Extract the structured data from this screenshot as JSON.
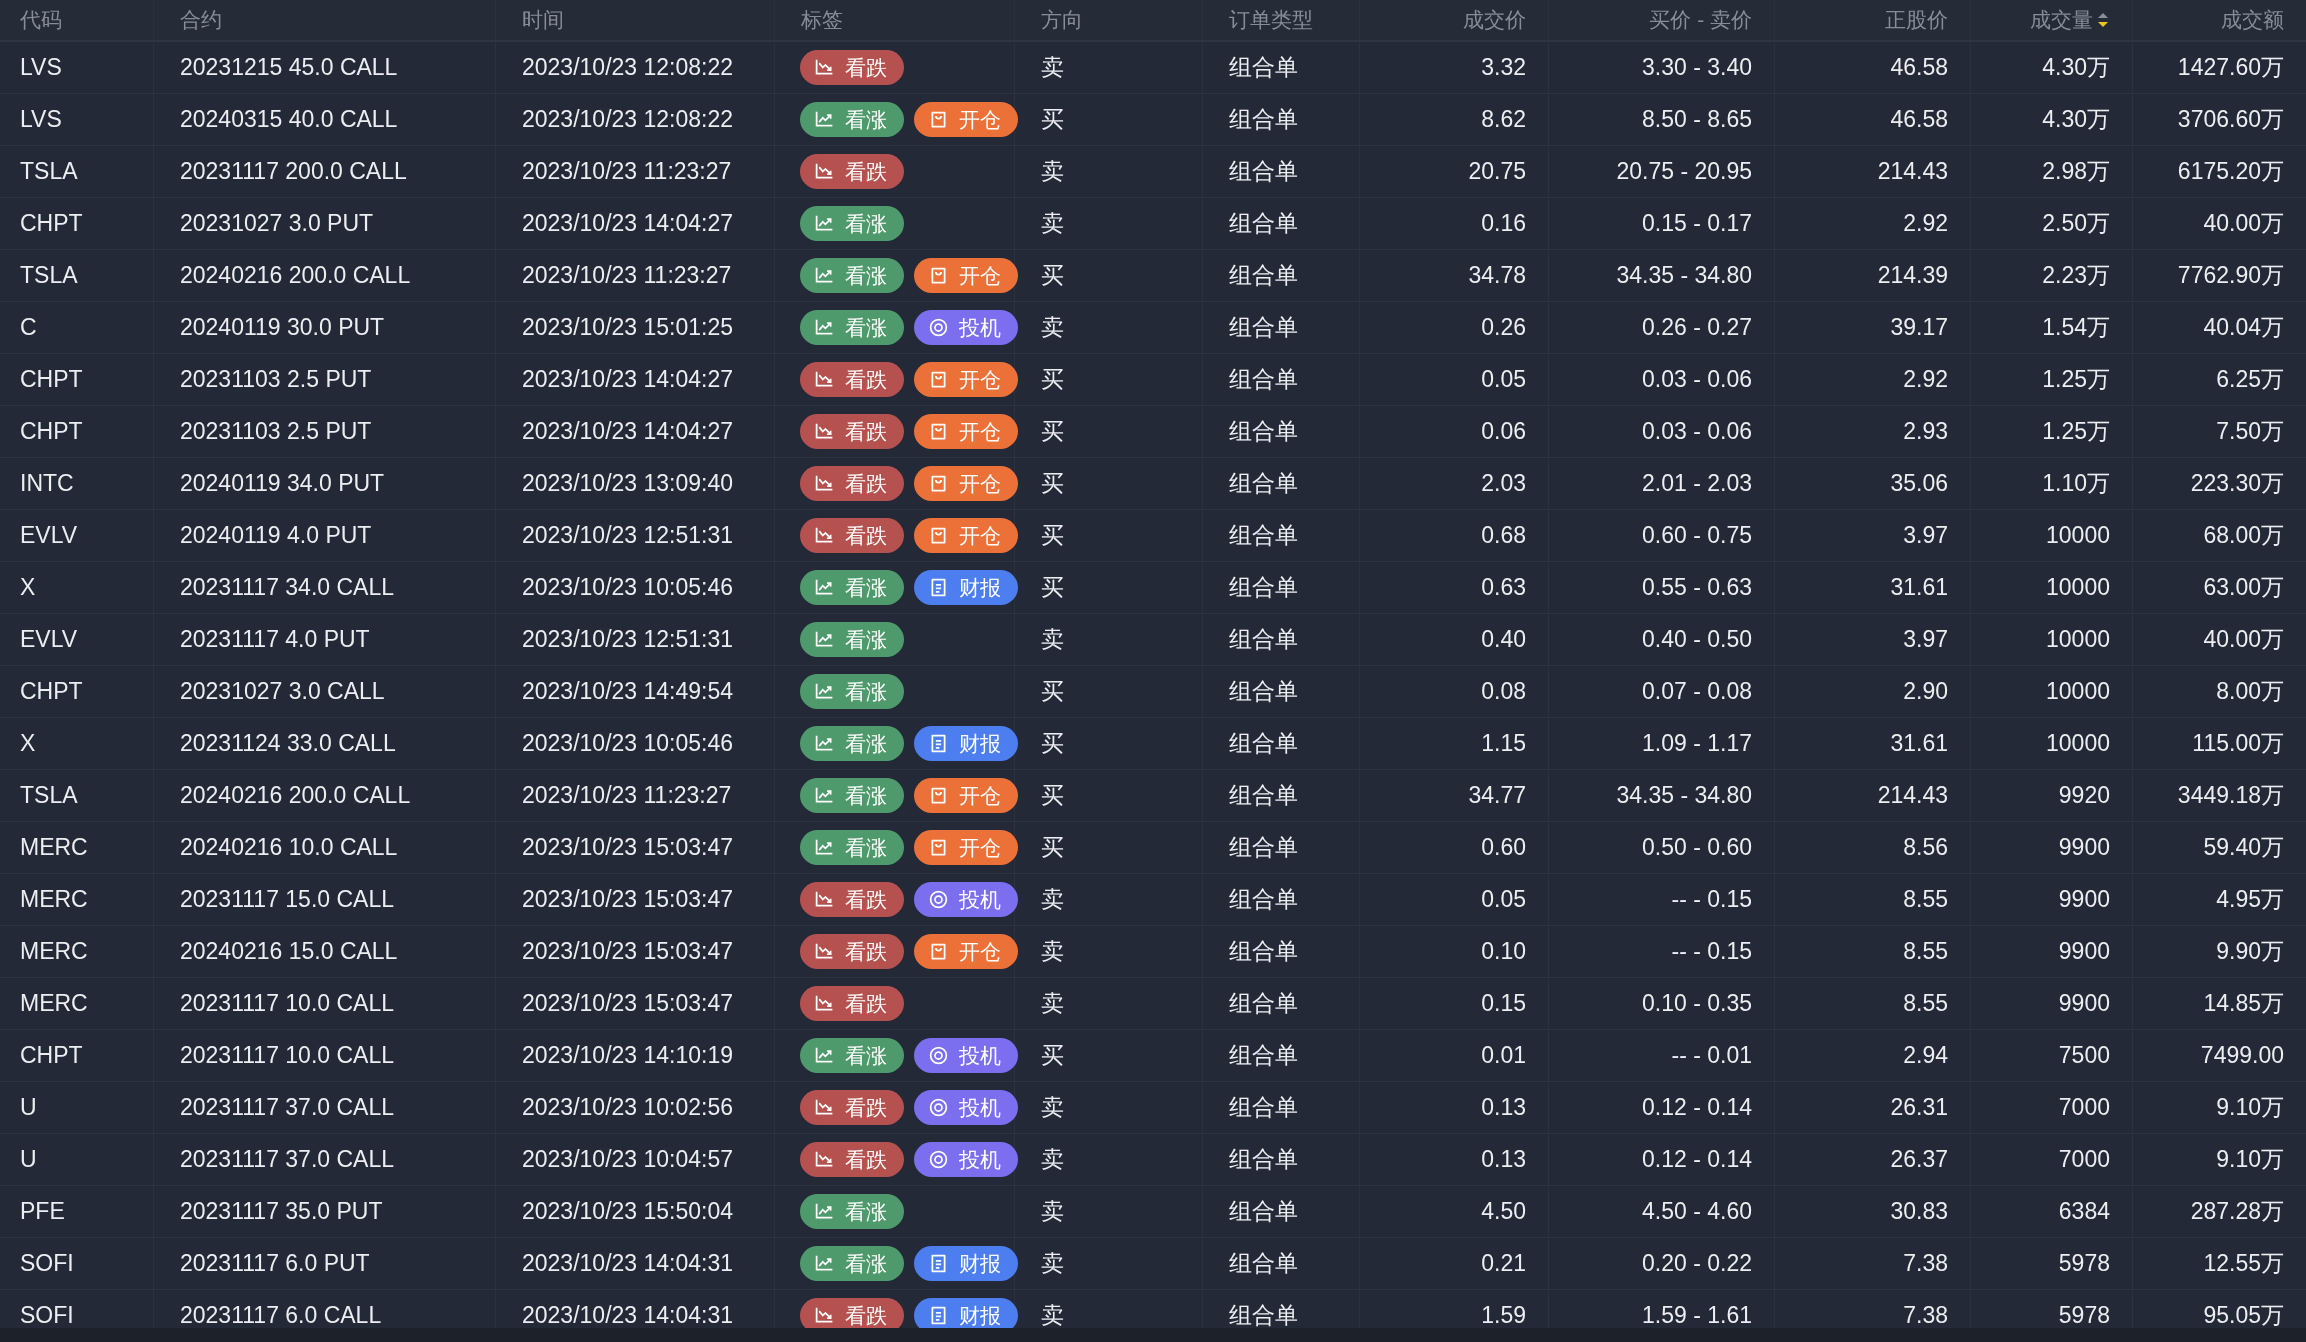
{
  "columns": [
    {
      "label": "代码"
    },
    {
      "label": "合约"
    },
    {
      "label": "时间"
    },
    {
      "label": "标签"
    },
    {
      "label": "方向"
    },
    {
      "label": "订单类型"
    },
    {
      "label": "成交价"
    },
    {
      "label": "买价 - 卖价"
    },
    {
      "label": "正股价"
    },
    {
      "label": "成交量",
      "sorted_descending": true
    },
    {
      "label": "成交额"
    }
  ],
  "rows": [
    {
      "code": "LVS",
      "contract": "20231215 45.0 CALL",
      "time": "2023/10/23 12:08:22",
      "tags": [
        {
          "kind": "bear",
          "label": "看跌"
        }
      ],
      "direction": "卖",
      "order_type": "组合单",
      "price": "3.32",
      "bid_ask": "3.30 - 3.40",
      "underlying": "46.58",
      "volume": "4.30万",
      "amount": "1427.60万"
    },
    {
      "code": "LVS",
      "contract": "20240315 40.0 CALL",
      "time": "2023/10/23 12:08:22",
      "tags": [
        {
          "kind": "bull",
          "label": "看涨"
        },
        {
          "kind": "open",
          "label": "开仓"
        }
      ],
      "direction": "买",
      "order_type": "组合单",
      "price": "8.62",
      "bid_ask": "8.50 - 8.65",
      "underlying": "46.58",
      "volume": "4.30万",
      "amount": "3706.60万"
    },
    {
      "code": "TSLA",
      "contract": "20231117 200.0 CALL",
      "time": "2023/10/23 11:23:27",
      "tags": [
        {
          "kind": "bear",
          "label": "看跌"
        }
      ],
      "direction": "卖",
      "order_type": "组合单",
      "price": "20.75",
      "bid_ask": "20.75 - 20.95",
      "underlying": "214.43",
      "volume": "2.98万",
      "amount": "6175.20万"
    },
    {
      "code": "CHPT",
      "contract": "20231027 3.0 PUT",
      "time": "2023/10/23 14:04:27",
      "tags": [
        {
          "kind": "bull",
          "label": "看涨"
        }
      ],
      "direction": "卖",
      "order_type": "组合单",
      "price": "0.16",
      "bid_ask": "0.15 - 0.17",
      "underlying": "2.92",
      "volume": "2.50万",
      "amount": "40.00万"
    },
    {
      "code": "TSLA",
      "contract": "20240216 200.0 CALL",
      "time": "2023/10/23 11:23:27",
      "tags": [
        {
          "kind": "bull",
          "label": "看涨"
        },
        {
          "kind": "open",
          "label": "开仓"
        }
      ],
      "direction": "买",
      "order_type": "组合单",
      "price": "34.78",
      "bid_ask": "34.35 - 34.80",
      "underlying": "214.39",
      "volume": "2.23万",
      "amount": "7762.90万"
    },
    {
      "code": "C",
      "contract": "20240119 30.0 PUT",
      "time": "2023/10/23 15:01:25",
      "tags": [
        {
          "kind": "bull",
          "label": "看涨"
        },
        {
          "kind": "spec",
          "label": "投机"
        }
      ],
      "direction": "卖",
      "order_type": "组合单",
      "price": "0.26",
      "bid_ask": "0.26 - 0.27",
      "underlying": "39.17",
      "volume": "1.54万",
      "amount": "40.04万"
    },
    {
      "code": "CHPT",
      "contract": "20231103 2.5 PUT",
      "time": "2023/10/23 14:04:27",
      "tags": [
        {
          "kind": "bear",
          "label": "看跌"
        },
        {
          "kind": "open",
          "label": "开仓"
        }
      ],
      "direction": "买",
      "order_type": "组合单",
      "price": "0.05",
      "bid_ask": "0.03 - 0.06",
      "underlying": "2.92",
      "volume": "1.25万",
      "amount": "6.25万"
    },
    {
      "code": "CHPT",
      "contract": "20231103 2.5 PUT",
      "time": "2023/10/23 14:04:27",
      "tags": [
        {
          "kind": "bear",
          "label": "看跌"
        },
        {
          "kind": "open",
          "label": "开仓"
        }
      ],
      "direction": "买",
      "order_type": "组合单",
      "price": "0.06",
      "bid_ask": "0.03 - 0.06",
      "underlying": "2.93",
      "volume": "1.25万",
      "amount": "7.50万"
    },
    {
      "code": "INTC",
      "contract": "20240119 34.0 PUT",
      "time": "2023/10/23 13:09:40",
      "tags": [
        {
          "kind": "bear",
          "label": "看跌"
        },
        {
          "kind": "open",
          "label": "开仓"
        }
      ],
      "direction": "买",
      "order_type": "组合单",
      "price": "2.03",
      "bid_ask": "2.01 - 2.03",
      "underlying": "35.06",
      "volume": "1.10万",
      "amount": "223.30万"
    },
    {
      "code": "EVLV",
      "contract": "20240119 4.0 PUT",
      "time": "2023/10/23 12:51:31",
      "tags": [
        {
          "kind": "bear",
          "label": "看跌"
        },
        {
          "kind": "open",
          "label": "开仓"
        }
      ],
      "direction": "买",
      "order_type": "组合单",
      "price": "0.68",
      "bid_ask": "0.60 - 0.75",
      "underlying": "3.97",
      "volume": "10000",
      "amount": "68.00万"
    },
    {
      "code": "X",
      "contract": "20231117 34.0 CALL",
      "time": "2023/10/23 10:05:46",
      "tags": [
        {
          "kind": "bull",
          "label": "看涨"
        },
        {
          "kind": "earnings",
          "label": "财报"
        }
      ],
      "direction": "买",
      "order_type": "组合单",
      "price": "0.63",
      "bid_ask": "0.55 - 0.63",
      "underlying": "31.61",
      "volume": "10000",
      "amount": "63.00万"
    },
    {
      "code": "EVLV",
      "contract": "20231117 4.0 PUT",
      "time": "2023/10/23 12:51:31",
      "tags": [
        {
          "kind": "bull",
          "label": "看涨"
        }
      ],
      "direction": "卖",
      "order_type": "组合单",
      "price": "0.40",
      "bid_ask": "0.40 - 0.50",
      "underlying": "3.97",
      "volume": "10000",
      "amount": "40.00万"
    },
    {
      "code": "CHPT",
      "contract": "20231027 3.0 CALL",
      "time": "2023/10/23 14:49:54",
      "tags": [
        {
          "kind": "bull",
          "label": "看涨"
        }
      ],
      "direction": "买",
      "order_type": "组合单",
      "price": "0.08",
      "bid_ask": "0.07 - 0.08",
      "underlying": "2.90",
      "volume": "10000",
      "amount": "8.00万"
    },
    {
      "code": "X",
      "contract": "20231124 33.0 CALL",
      "time": "2023/10/23 10:05:46",
      "tags": [
        {
          "kind": "bull",
          "label": "看涨"
        },
        {
          "kind": "earnings",
          "label": "财报"
        }
      ],
      "direction": "买",
      "order_type": "组合单",
      "price": "1.15",
      "bid_ask": "1.09 - 1.17",
      "underlying": "31.61",
      "volume": "10000",
      "amount": "115.00万"
    },
    {
      "code": "TSLA",
      "contract": "20240216 200.0 CALL",
      "time": "2023/10/23 11:23:27",
      "tags": [
        {
          "kind": "bull",
          "label": "看涨"
        },
        {
          "kind": "open",
          "label": "开仓"
        }
      ],
      "direction": "买",
      "order_type": "组合单",
      "price": "34.77",
      "bid_ask": "34.35 - 34.80",
      "underlying": "214.43",
      "volume": "9920",
      "amount": "3449.18万"
    },
    {
      "code": "MERC",
      "contract": "20240216 10.0 CALL",
      "time": "2023/10/23 15:03:47",
      "tags": [
        {
          "kind": "bull",
          "label": "看涨"
        },
        {
          "kind": "open",
          "label": "开仓"
        }
      ],
      "direction": "买",
      "order_type": "组合单",
      "price": "0.60",
      "bid_ask": "0.50 - 0.60",
      "underlying": "8.56",
      "volume": "9900",
      "amount": "59.40万"
    },
    {
      "code": "MERC",
      "contract": "20231117 15.0 CALL",
      "time": "2023/10/23 15:03:47",
      "tags": [
        {
          "kind": "bear",
          "label": "看跌"
        },
        {
          "kind": "spec",
          "label": "投机"
        }
      ],
      "direction": "卖",
      "order_type": "组合单",
      "price": "0.05",
      "bid_ask": "-- - 0.15",
      "underlying": "8.55",
      "volume": "9900",
      "amount": "4.95万"
    },
    {
      "code": "MERC",
      "contract": "20240216 15.0 CALL",
      "time": "2023/10/23 15:03:47",
      "tags": [
        {
          "kind": "bear",
          "label": "看跌"
        },
        {
          "kind": "open",
          "label": "开仓"
        }
      ],
      "direction": "卖",
      "order_type": "组合单",
      "price": "0.10",
      "bid_ask": "-- - 0.15",
      "underlying": "8.55",
      "volume": "9900",
      "amount": "9.90万"
    },
    {
      "code": "MERC",
      "contract": "20231117 10.0 CALL",
      "time": "2023/10/23 15:03:47",
      "tags": [
        {
          "kind": "bear",
          "label": "看跌"
        }
      ],
      "direction": "卖",
      "order_type": "组合单",
      "price": "0.15",
      "bid_ask": "0.10 - 0.35",
      "underlying": "8.55",
      "volume": "9900",
      "amount": "14.85万"
    },
    {
      "code": "CHPT",
      "contract": "20231117 10.0 CALL",
      "time": "2023/10/23 14:10:19",
      "tags": [
        {
          "kind": "bull",
          "label": "看涨"
        },
        {
          "kind": "spec",
          "label": "投机"
        }
      ],
      "direction": "买",
      "order_type": "组合单",
      "price": "0.01",
      "bid_ask": "-- - 0.01",
      "underlying": "2.94",
      "volume": "7500",
      "amount": "7499.00"
    },
    {
      "code": "U",
      "contract": "20231117 37.0 CALL",
      "time": "2023/10/23 10:02:56",
      "tags": [
        {
          "kind": "bear",
          "label": "看跌"
        },
        {
          "kind": "spec",
          "label": "投机"
        }
      ],
      "direction": "卖",
      "order_type": "组合单",
      "price": "0.13",
      "bid_ask": "0.12 - 0.14",
      "underlying": "26.31",
      "volume": "7000",
      "amount": "9.10万"
    },
    {
      "code": "U",
      "contract": "20231117 37.0 CALL",
      "time": "2023/10/23 10:04:57",
      "tags": [
        {
          "kind": "bear",
          "label": "看跌"
        },
        {
          "kind": "spec",
          "label": "投机"
        }
      ],
      "direction": "卖",
      "order_type": "组合单",
      "price": "0.13",
      "bid_ask": "0.12 - 0.14",
      "underlying": "26.37",
      "volume": "7000",
      "amount": "9.10万"
    },
    {
      "code": "PFE",
      "contract": "20231117 35.0 PUT",
      "time": "2023/10/23 15:50:04",
      "tags": [
        {
          "kind": "bull",
          "label": "看涨"
        }
      ],
      "direction": "卖",
      "order_type": "组合单",
      "price": "4.50",
      "bid_ask": "4.50 - 4.60",
      "underlying": "30.83",
      "volume": "6384",
      "amount": "287.28万"
    },
    {
      "code": "SOFI",
      "contract": "20231117 6.0 PUT",
      "time": "2023/10/23 14:04:31",
      "tags": [
        {
          "kind": "bull",
          "label": "看涨"
        },
        {
          "kind": "earnings",
          "label": "财报"
        }
      ],
      "direction": "卖",
      "order_type": "组合单",
      "price": "0.21",
      "bid_ask": "0.20 - 0.22",
      "underlying": "7.38",
      "volume": "5978",
      "amount": "12.55万"
    },
    {
      "code": "SOFI",
      "contract": "20231117 6.0 CALL",
      "time": "2023/10/23 14:04:31",
      "tags": [
        {
          "kind": "bear",
          "label": "看跌"
        },
        {
          "kind": "earnings",
          "label": "财报"
        }
      ],
      "direction": "卖",
      "order_type": "组合单",
      "price": "1.59",
      "bid_ask": "1.59 - 1.61",
      "underlying": "7.38",
      "volume": "5978",
      "amount": "95.05万"
    }
  ]
}
